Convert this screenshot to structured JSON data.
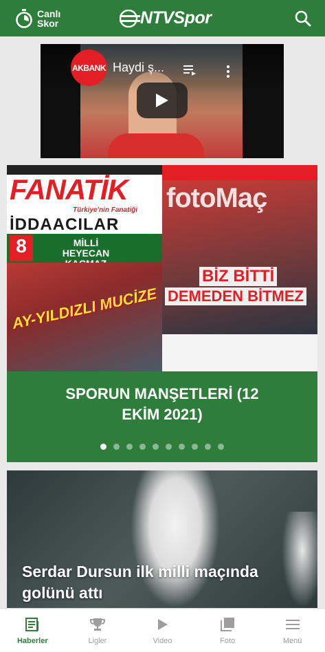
{
  "header": {
    "live_score_line1": "Canlı",
    "live_score_line2": "Skor",
    "logo_text": "NTVSpor"
  },
  "video": {
    "channel_label": "AKBANK",
    "title": "Haydi ş..."
  },
  "carousel": {
    "fanatik": {
      "masthead": "FANATİK",
      "subtitle": "Türkiye'nin Fanatiği",
      "banner": "İDDAACILAR",
      "page_number": "8",
      "promo_line1": "MİLLİ",
      "promo_line2": "HEYECAN",
      "promo_line3": "KAÇMAZ",
      "headline": "AY-YILDIZLI MUCİZE"
    },
    "fotomac": {
      "masthead": "fotoMaç",
      "headline_line1": "BİZ BİTTİ",
      "headline_line2": "DEMEDEN BİTMEZ"
    },
    "headline": "SPORUN MANŞETLERİ (12 EKİM 2021)",
    "dot_count": 10,
    "active_index": 0
  },
  "news": {
    "title": "Serdar Dursun ilk milli maçında golünü attı"
  },
  "tabbar": {
    "items": [
      {
        "label": "Haberler",
        "icon": "news-icon",
        "active": true
      },
      {
        "label": "Ligler",
        "icon": "trophy-icon",
        "active": false
      },
      {
        "label": "Video",
        "icon": "play-icon",
        "active": false
      },
      {
        "label": "Foto",
        "icon": "photo-icon",
        "active": false
      },
      {
        "label": "Menü",
        "icon": "menu-icon",
        "active": false
      }
    ]
  },
  "colors": {
    "brand_green": "#2e7d3a",
    "inactive_tab": "#9e9e9e"
  }
}
